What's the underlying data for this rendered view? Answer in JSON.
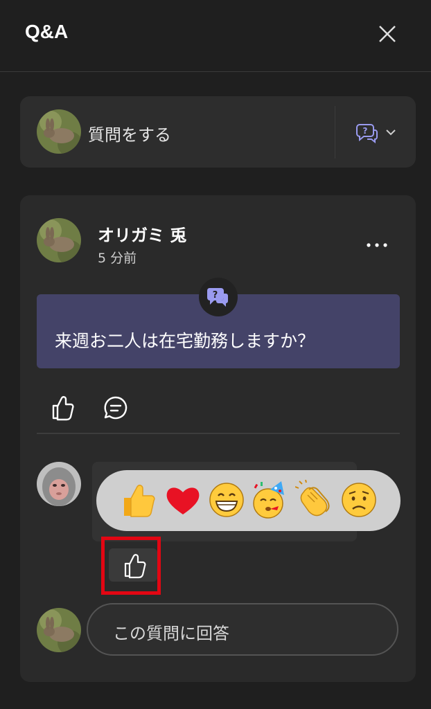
{
  "header": {
    "title": "Q&A"
  },
  "ask": {
    "placeholder": "質問をする"
  },
  "question": {
    "author": "オリガミ 兎",
    "time": "5 分前",
    "text": "来週お二人は在宅勤務しますか？"
  },
  "reactions": [
    "like",
    "heart",
    "laugh",
    "party",
    "clap",
    "sad"
  ],
  "answer_input": {
    "placeholder": "この質問に回答"
  },
  "colors": {
    "question_box": "#444368",
    "accent": "#9a9bf0",
    "highlight": "#e30613"
  }
}
